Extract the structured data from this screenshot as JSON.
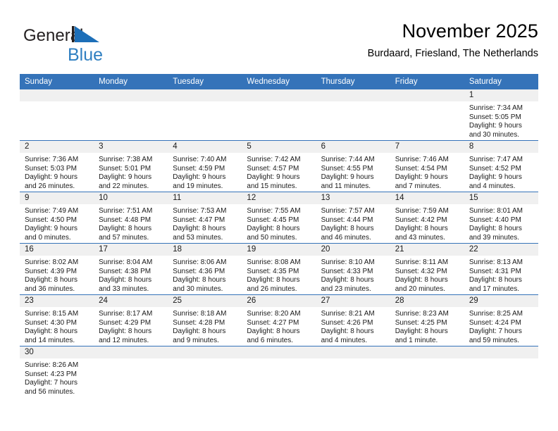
{
  "brand": {
    "name_top": "General",
    "name_bottom": "Blue",
    "top_color": "#231f20",
    "bottom_color": "#2f7fc1",
    "mark_color": "#1d6fb8",
    "icon": "general-blue-logo"
  },
  "header": {
    "title": "November 2025",
    "subtitle": "Burdaard, Friesland, The Netherlands"
  },
  "theme": {
    "header_band": "#3573b9",
    "row_divider": "#3573b9",
    "daynum_band": "#f0f0f0",
    "text": "#1a1a1a"
  },
  "weekdays": [
    "Sunday",
    "Monday",
    "Tuesday",
    "Wednesday",
    "Thursday",
    "Friday",
    "Saturday"
  ],
  "labels": {
    "sunrise": "Sunrise:",
    "sunset": "Sunset:",
    "daylight": "Daylight:"
  },
  "weeks": [
    [
      {
        "blank": true
      },
      {
        "blank": true
      },
      {
        "blank": true
      },
      {
        "blank": true
      },
      {
        "blank": true
      },
      {
        "blank": true
      },
      {
        "day": "1",
        "sunrise": "Sunrise: 7:34 AM",
        "sunset": "Sunset: 5:05 PM",
        "daylight1": "Daylight: 9 hours",
        "daylight2": "and 30 minutes."
      }
    ],
    [
      {
        "day": "2",
        "sunrise": "Sunrise: 7:36 AM",
        "sunset": "Sunset: 5:03 PM",
        "daylight1": "Daylight: 9 hours",
        "daylight2": "and 26 minutes."
      },
      {
        "day": "3",
        "sunrise": "Sunrise: 7:38 AM",
        "sunset": "Sunset: 5:01 PM",
        "daylight1": "Daylight: 9 hours",
        "daylight2": "and 22 minutes."
      },
      {
        "day": "4",
        "sunrise": "Sunrise: 7:40 AM",
        "sunset": "Sunset: 4:59 PM",
        "daylight1": "Daylight: 9 hours",
        "daylight2": "and 19 minutes."
      },
      {
        "day": "5",
        "sunrise": "Sunrise: 7:42 AM",
        "sunset": "Sunset: 4:57 PM",
        "daylight1": "Daylight: 9 hours",
        "daylight2": "and 15 minutes."
      },
      {
        "day": "6",
        "sunrise": "Sunrise: 7:44 AM",
        "sunset": "Sunset: 4:55 PM",
        "daylight1": "Daylight: 9 hours",
        "daylight2": "and 11 minutes."
      },
      {
        "day": "7",
        "sunrise": "Sunrise: 7:46 AM",
        "sunset": "Sunset: 4:54 PM",
        "daylight1": "Daylight: 9 hours",
        "daylight2": "and 7 minutes."
      },
      {
        "day": "8",
        "sunrise": "Sunrise: 7:47 AM",
        "sunset": "Sunset: 4:52 PM",
        "daylight1": "Daylight: 9 hours",
        "daylight2": "and 4 minutes."
      }
    ],
    [
      {
        "day": "9",
        "sunrise": "Sunrise: 7:49 AM",
        "sunset": "Sunset: 4:50 PM",
        "daylight1": "Daylight: 9 hours",
        "daylight2": "and 0 minutes."
      },
      {
        "day": "10",
        "sunrise": "Sunrise: 7:51 AM",
        "sunset": "Sunset: 4:48 PM",
        "daylight1": "Daylight: 8 hours",
        "daylight2": "and 57 minutes."
      },
      {
        "day": "11",
        "sunrise": "Sunrise: 7:53 AM",
        "sunset": "Sunset: 4:47 PM",
        "daylight1": "Daylight: 8 hours",
        "daylight2": "and 53 minutes."
      },
      {
        "day": "12",
        "sunrise": "Sunrise: 7:55 AM",
        "sunset": "Sunset: 4:45 PM",
        "daylight1": "Daylight: 8 hours",
        "daylight2": "and 50 minutes."
      },
      {
        "day": "13",
        "sunrise": "Sunrise: 7:57 AM",
        "sunset": "Sunset: 4:44 PM",
        "daylight1": "Daylight: 8 hours",
        "daylight2": "and 46 minutes."
      },
      {
        "day": "14",
        "sunrise": "Sunrise: 7:59 AM",
        "sunset": "Sunset: 4:42 PM",
        "daylight1": "Daylight: 8 hours",
        "daylight2": "and 43 minutes."
      },
      {
        "day": "15",
        "sunrise": "Sunrise: 8:01 AM",
        "sunset": "Sunset: 4:40 PM",
        "daylight1": "Daylight: 8 hours",
        "daylight2": "and 39 minutes."
      }
    ],
    [
      {
        "day": "16",
        "sunrise": "Sunrise: 8:02 AM",
        "sunset": "Sunset: 4:39 PM",
        "daylight1": "Daylight: 8 hours",
        "daylight2": "and 36 minutes."
      },
      {
        "day": "17",
        "sunrise": "Sunrise: 8:04 AM",
        "sunset": "Sunset: 4:38 PM",
        "daylight1": "Daylight: 8 hours",
        "daylight2": "and 33 minutes."
      },
      {
        "day": "18",
        "sunrise": "Sunrise: 8:06 AM",
        "sunset": "Sunset: 4:36 PM",
        "daylight1": "Daylight: 8 hours",
        "daylight2": "and 30 minutes."
      },
      {
        "day": "19",
        "sunrise": "Sunrise: 8:08 AM",
        "sunset": "Sunset: 4:35 PM",
        "daylight1": "Daylight: 8 hours",
        "daylight2": "and 26 minutes."
      },
      {
        "day": "20",
        "sunrise": "Sunrise: 8:10 AM",
        "sunset": "Sunset: 4:33 PM",
        "daylight1": "Daylight: 8 hours",
        "daylight2": "and 23 minutes."
      },
      {
        "day": "21",
        "sunrise": "Sunrise: 8:11 AM",
        "sunset": "Sunset: 4:32 PM",
        "daylight1": "Daylight: 8 hours",
        "daylight2": "and 20 minutes."
      },
      {
        "day": "22",
        "sunrise": "Sunrise: 8:13 AM",
        "sunset": "Sunset: 4:31 PM",
        "daylight1": "Daylight: 8 hours",
        "daylight2": "and 17 minutes."
      }
    ],
    [
      {
        "day": "23",
        "sunrise": "Sunrise: 8:15 AM",
        "sunset": "Sunset: 4:30 PM",
        "daylight1": "Daylight: 8 hours",
        "daylight2": "and 14 minutes."
      },
      {
        "day": "24",
        "sunrise": "Sunrise: 8:17 AM",
        "sunset": "Sunset: 4:29 PM",
        "daylight1": "Daylight: 8 hours",
        "daylight2": "and 12 minutes."
      },
      {
        "day": "25",
        "sunrise": "Sunrise: 8:18 AM",
        "sunset": "Sunset: 4:28 PM",
        "daylight1": "Daylight: 8 hours",
        "daylight2": "and 9 minutes."
      },
      {
        "day": "26",
        "sunrise": "Sunrise: 8:20 AM",
        "sunset": "Sunset: 4:27 PM",
        "daylight1": "Daylight: 8 hours",
        "daylight2": "and 6 minutes."
      },
      {
        "day": "27",
        "sunrise": "Sunrise: 8:21 AM",
        "sunset": "Sunset: 4:26 PM",
        "daylight1": "Daylight: 8 hours",
        "daylight2": "and 4 minutes."
      },
      {
        "day": "28",
        "sunrise": "Sunrise: 8:23 AM",
        "sunset": "Sunset: 4:25 PM",
        "daylight1": "Daylight: 8 hours",
        "daylight2": "and 1 minute."
      },
      {
        "day": "29",
        "sunrise": "Sunrise: 8:25 AM",
        "sunset": "Sunset: 4:24 PM",
        "daylight1": "Daylight: 7 hours",
        "daylight2": "and 59 minutes."
      }
    ],
    [
      {
        "day": "30",
        "sunrise": "Sunrise: 8:26 AM",
        "sunset": "Sunset: 4:23 PM",
        "daylight1": "Daylight: 7 hours",
        "daylight2": "and 56 minutes."
      },
      {
        "empty": true
      },
      {
        "empty": true
      },
      {
        "empty": true
      },
      {
        "empty": true
      },
      {
        "empty": true
      },
      {
        "empty": true
      }
    ]
  ]
}
